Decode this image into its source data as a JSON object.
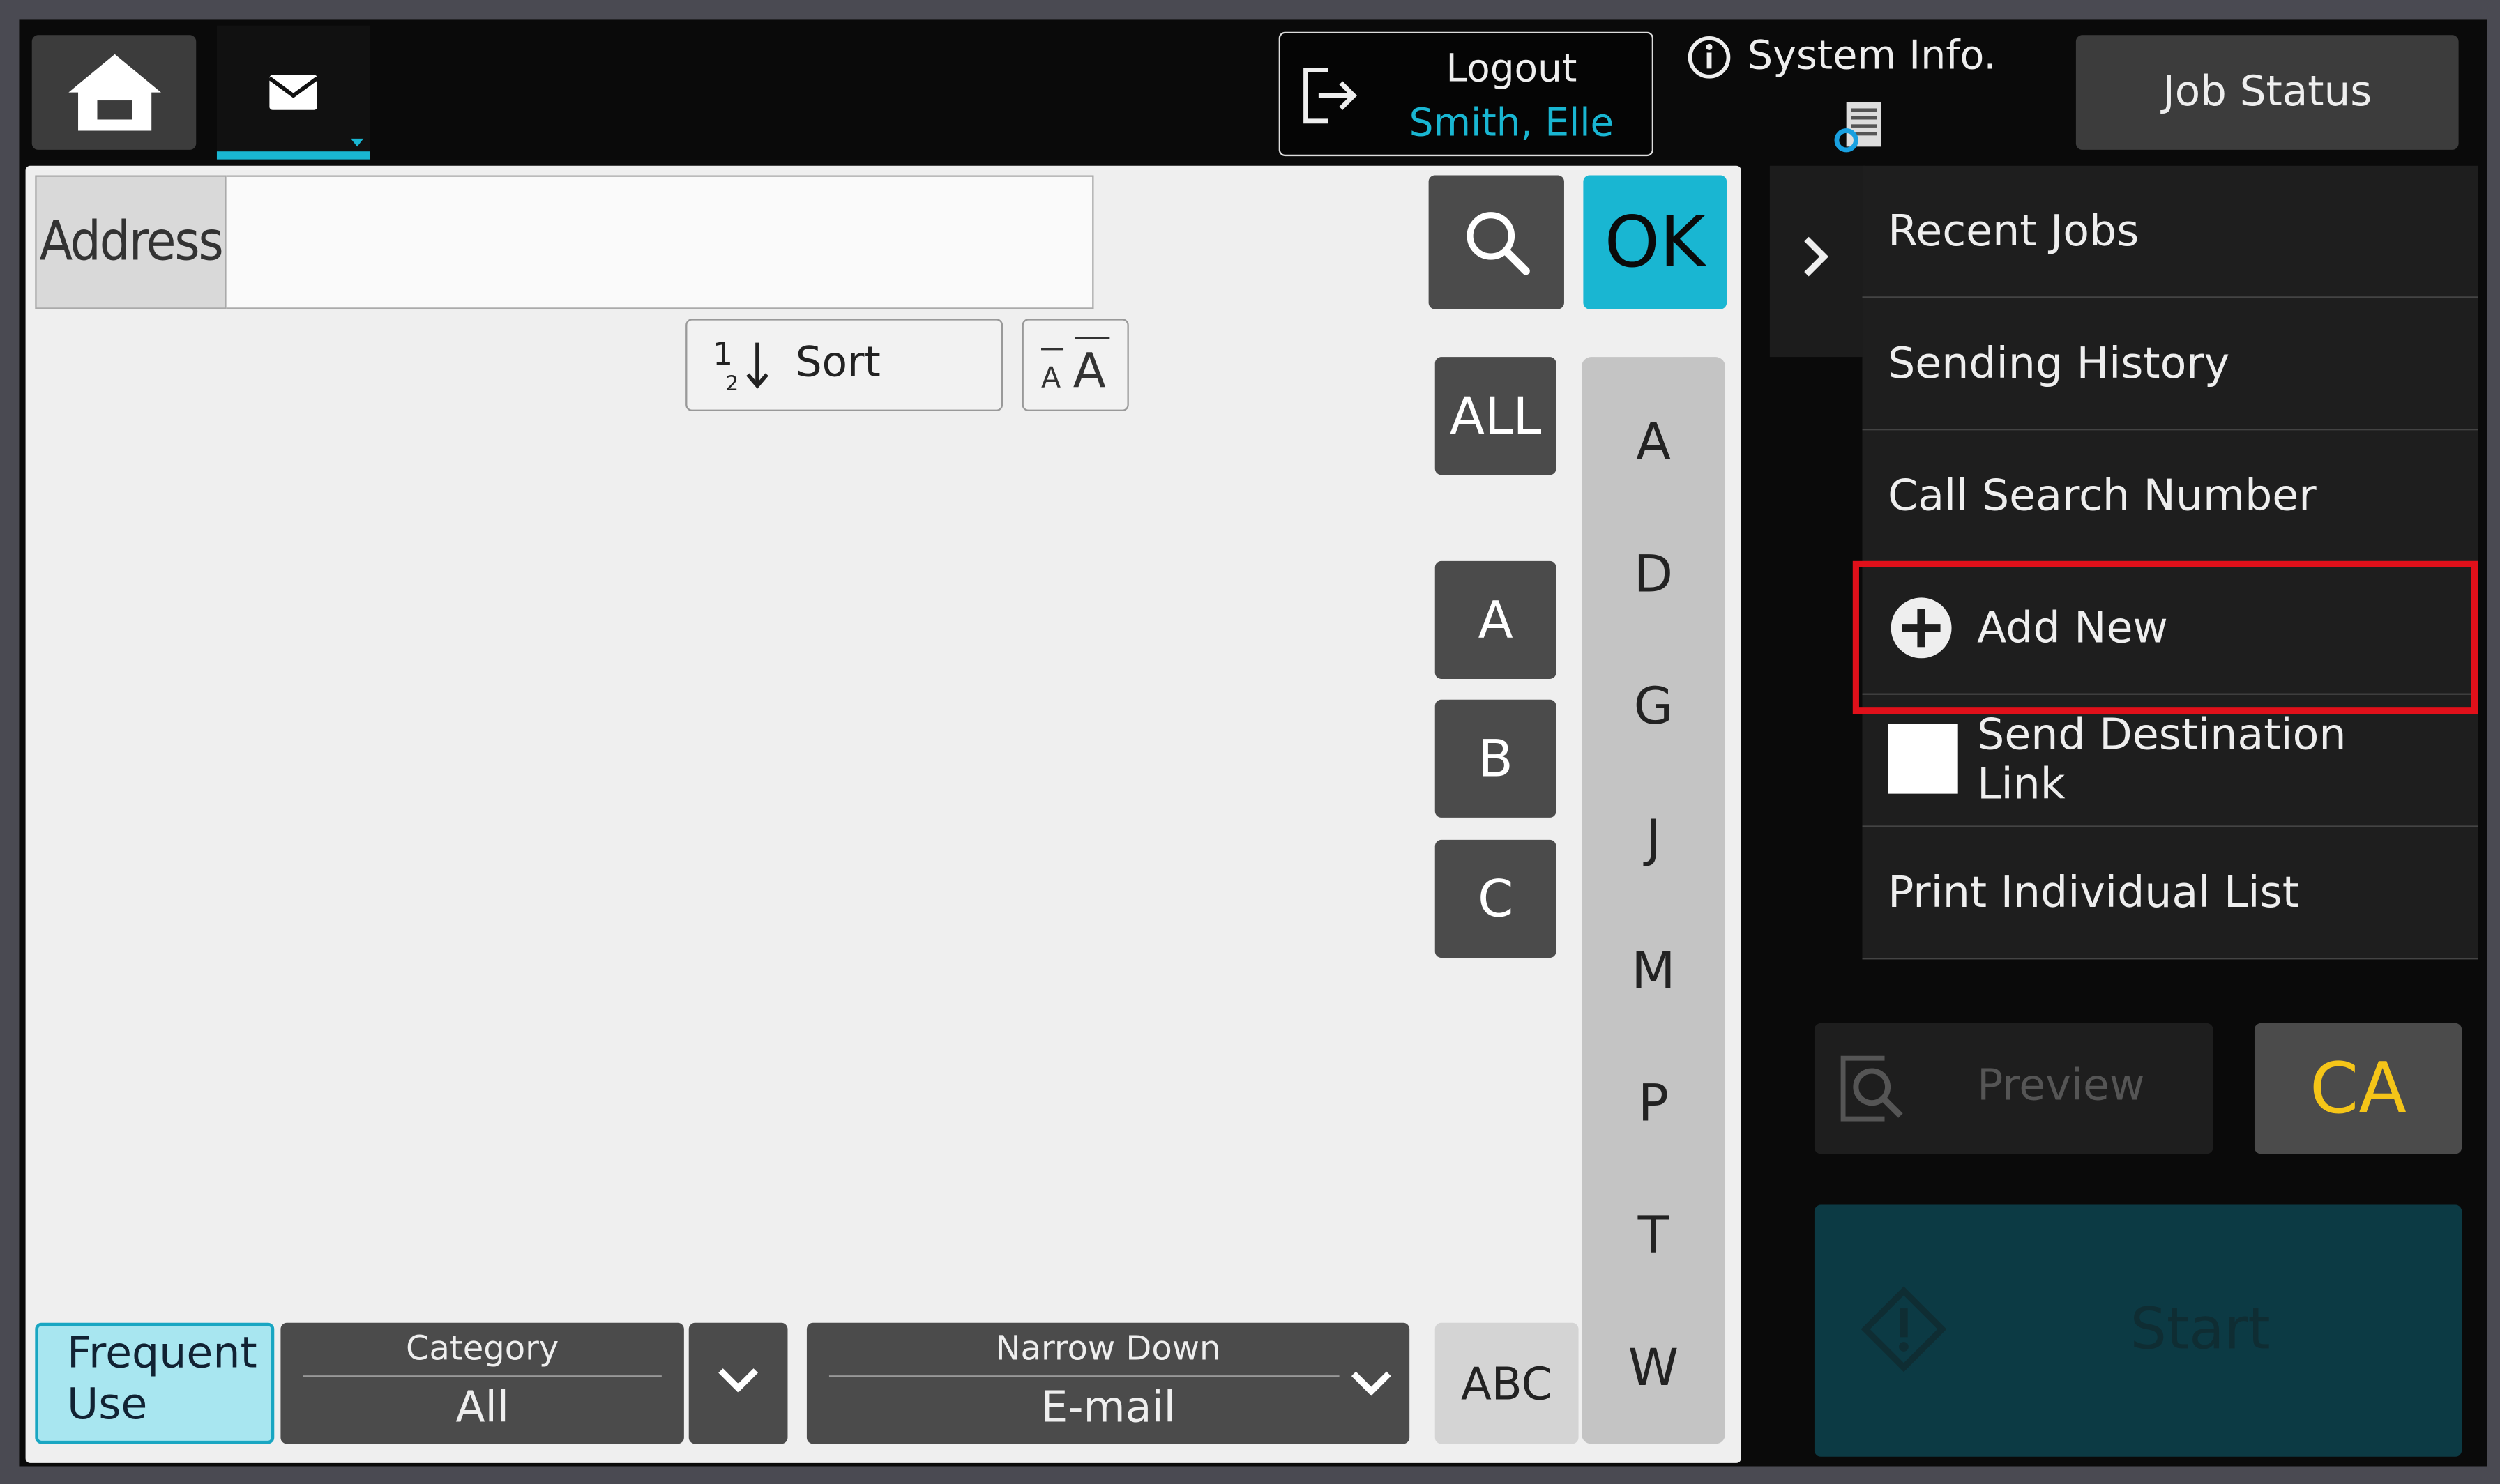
{
  "header": {
    "logout_label": "Logout",
    "user_name": "Smith, Elle",
    "system_info_label": "System Info.",
    "job_status_label": "Job Status"
  },
  "address": {
    "label": "Address",
    "value": ""
  },
  "toolbar": {
    "sort_label": "Sort",
    "ok_label": "OK"
  },
  "index_buttons": [
    "ALL",
    "A",
    "B",
    "C"
  ],
  "alphabet_bar": [
    "A",
    "D",
    "G",
    "J",
    "M",
    "P",
    "T",
    "W"
  ],
  "abc_label": "ABC",
  "filters": {
    "frequent_use_label": "Frequent Use",
    "category_label": "Category",
    "category_value": "All",
    "narrow_down_label": "Narrow Down",
    "narrow_down_value": "E-mail"
  },
  "side_menu": {
    "items": [
      "Recent Jobs",
      "Sending History",
      "Call Search Number",
      "Add New",
      "Send Destination Link",
      "Print Individual List"
    ]
  },
  "actions": {
    "preview_label": "Preview",
    "ca_label": "CA",
    "start_label": "Start"
  },
  "colors": {
    "accent": "#19b6d2",
    "highlight_box": "#e0101a",
    "ca_text": "#f5c518"
  }
}
